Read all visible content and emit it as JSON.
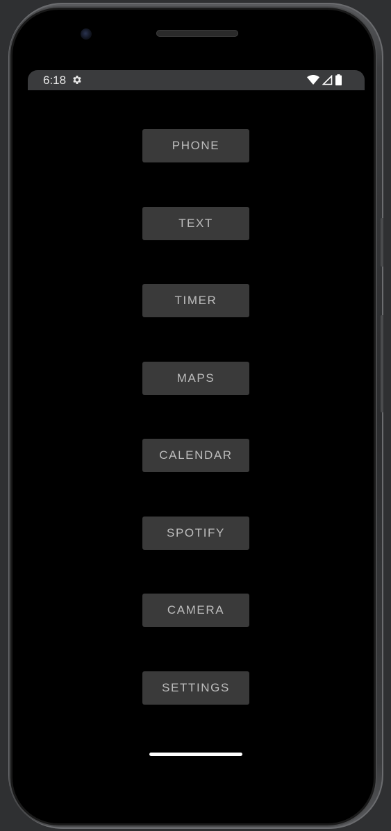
{
  "status_bar": {
    "time": "6:18",
    "icons": [
      "gear-icon",
      "wifi-icon",
      "cellular-signal-icon",
      "battery-icon"
    ]
  },
  "app_buttons": [
    {
      "label": "PHONE"
    },
    {
      "label": "TEXT"
    },
    {
      "label": "TIMER"
    },
    {
      "label": "MAPS"
    },
    {
      "label": "CALENDAR"
    },
    {
      "label": "SPOTIFY"
    },
    {
      "label": "CAMERA"
    },
    {
      "label": "SETTINGS"
    }
  ],
  "colors": {
    "background": "#000000",
    "button_bg": "#3a3a3a",
    "button_text": "#bdbdbd",
    "status_bar_bg": "#3a3b3d",
    "frame": "#2f3032"
  }
}
